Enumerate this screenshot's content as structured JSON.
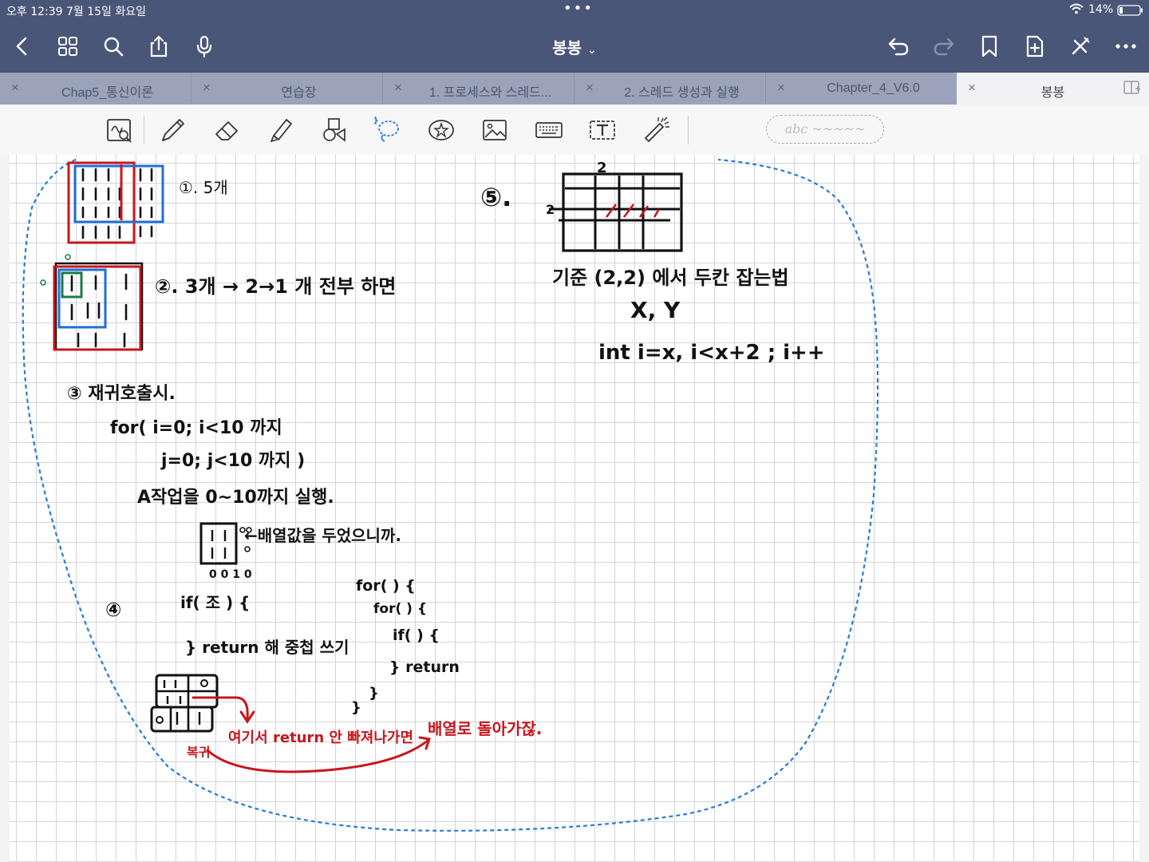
{
  "status_bar": {
    "time_date": "오후 12:39   7월 15일 화요일",
    "battery": "14%"
  },
  "header": {
    "title": "봉봉",
    "title_chevron": "⌄"
  },
  "tabs": [
    {
      "label": "Chap5_통신이론",
      "close": "×"
    },
    {
      "label": "연습장",
      "close": "×"
    },
    {
      "label": "1. 프로세스와 스레드...",
      "close": "×"
    },
    {
      "label": "2. 스레드 생성과 실행",
      "close": "×"
    },
    {
      "label": "Chapter_4_V6.0",
      "close": "×"
    },
    {
      "label": "봉봉",
      "close": "×",
      "active": true
    }
  ],
  "toolbar": {
    "text_preview": "abc ~~~~~"
  },
  "handwriting": {
    "n1": "①. 5개",
    "n2": "②. 3개 → 2→1 개 전부 하면",
    "n3_head": "③ 재귀호출시.",
    "n3_l1": "for( i=0; i<10 까지",
    "n3_l2": "j=0; j<10 까지 )",
    "n3_l3": "A작업을 0~10까지 실행.",
    "n3_note": "←배열값을 두었으니까.",
    "n3_sub": "0 0 1 0",
    "n4_head": "④",
    "n4_if": "if( 조 ) {",
    "n4_return": "} return 해 중첩 쓰기",
    "code_l1": "for(  ) {",
    "code_l2": "for(  ) {",
    "code_l3": "if(  ) {",
    "code_l4": "} return",
    "code_l5": "}",
    "code_l6": "}",
    "red1": "여기서 return 안 빠져나가면",
    "red2": "배열로 돌아가잖.",
    "red3": "복귀",
    "n5_head": "⑤.",
    "n5_top": "2",
    "n5_left": "2",
    "n5_l1": "기준 (2,2) 에서 두칸 잡는법",
    "n5_l2": "X, Y",
    "n5_l3": "int i=x, i<x+2 ; i++"
  },
  "colors": {
    "header_bg": "#4a5678",
    "tabs_bg": "#9aa3b9",
    "ink_black": "#111111",
    "ink_red": "#c8161d",
    "ink_blue": "#1f6fd6",
    "ink_green": "#1c7a4a",
    "lasso_blue": "#2a7bd4"
  },
  "icons": [
    "back-icon",
    "grid-icon",
    "search-icon",
    "share-icon",
    "mic-icon",
    "undo-icon",
    "redo-icon",
    "bookmark-icon",
    "add-page-icon",
    "close-pen-icon",
    "more-icon"
  ]
}
